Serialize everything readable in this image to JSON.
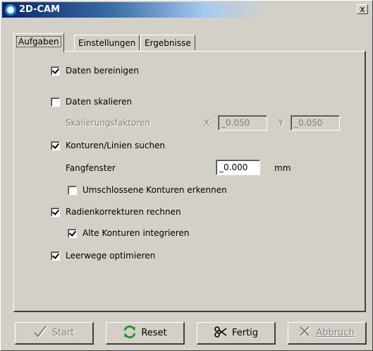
{
  "window": {
    "title": "2D-CAM",
    "close_glyph": "x"
  },
  "tabs": [
    {
      "label": "Aufgaben",
      "active": true
    },
    {
      "label": "Einstellungen",
      "active": false
    },
    {
      "label": "Ergebnisse",
      "active": false
    }
  ],
  "options": {
    "daten_bereinigen": {
      "label": "Daten bereinigen",
      "checked": true
    },
    "daten_skalieren": {
      "label": "Daten skalieren",
      "checked": false
    },
    "skalierungsfaktoren": {
      "label": "Skalierungsfaktoren",
      "x_label": "X",
      "x_value": "_0.050",
      "y_label": "Y",
      "y_value": "_0.050"
    },
    "konturen_suchen": {
      "label": "Konturen/Linien suchen",
      "checked": true
    },
    "fangfenster": {
      "label": "Fangfenster",
      "value": "_0.000",
      "unit": "mm"
    },
    "umschlossene": {
      "label": "Umschlossene Konturen erkennen",
      "checked": false
    },
    "radienkorrekturen": {
      "label": "Radienkorrekturen rechnen",
      "checked": true
    },
    "alte_konturen": {
      "label": "Alte Konturen integrieren",
      "checked": true
    },
    "leerwege": {
      "label": "Leerwege optimieren",
      "checked": true
    }
  },
  "buttons": {
    "start": {
      "label": "Start",
      "icon": "check-icon",
      "enabled": false
    },
    "reset": {
      "label": "Reset",
      "icon": "refresh-icon",
      "enabled": true
    },
    "fertig": {
      "label": "Fertig",
      "icon": "scissors-icon",
      "enabled": true
    },
    "abbruch": {
      "label": "Abbruch",
      "icon": "cancel-icon",
      "enabled": false
    }
  },
  "colors": {
    "face": "#d4d0c8",
    "title_start": "#08246b",
    "reset_icon": "#1e9a2e"
  }
}
